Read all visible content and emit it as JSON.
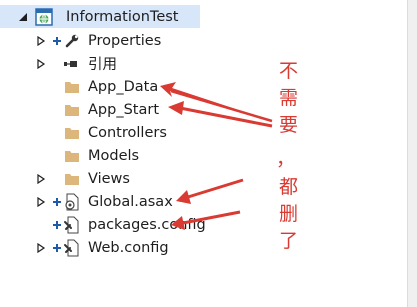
{
  "tree": {
    "root": {
      "label": "InformationTest"
    },
    "items": [
      {
        "label": "Properties"
      },
      {
        "label": "引用"
      },
      {
        "label": "App_Data"
      },
      {
        "label": "App_Start"
      },
      {
        "label": "Controllers"
      },
      {
        "label": "Models"
      },
      {
        "label": "Views"
      },
      {
        "label": "Global.asax"
      },
      {
        "label": "packages.config"
      },
      {
        "label": "Web.config"
      }
    ]
  },
  "annotation": {
    "chars": [
      "不",
      "需",
      "要",
      "，",
      "都",
      "删",
      "了"
    ]
  },
  "colors": {
    "annotation_red": "#d93a32",
    "folder_tan": "#dcb67a",
    "selection_blue": "#d7e6f8",
    "plus_blue": "#1e5aa8"
  }
}
